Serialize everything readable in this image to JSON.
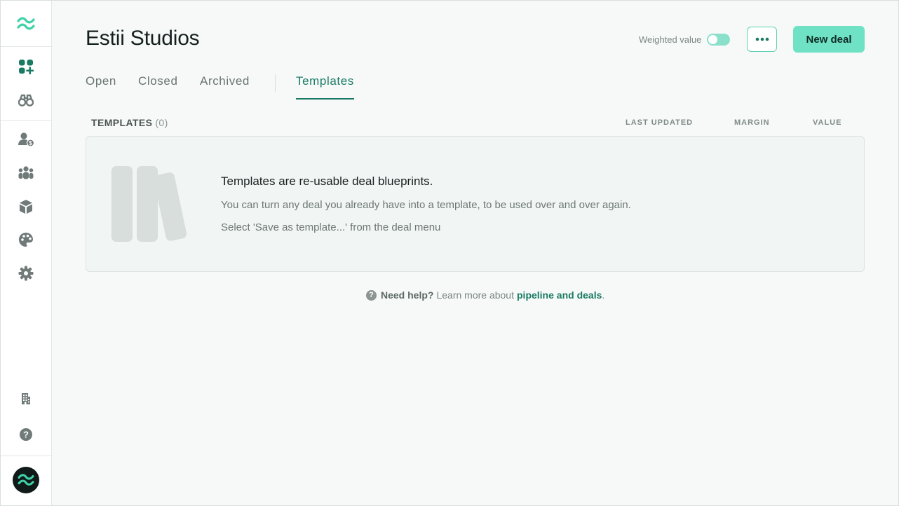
{
  "app": {
    "workspace_title": "Estii Studios"
  },
  "sidebar": {
    "items": [
      {
        "name": "deals-icon"
      },
      {
        "name": "discover-icon"
      },
      {
        "name": "clients-icon"
      },
      {
        "name": "team-icon"
      },
      {
        "name": "products-icon"
      },
      {
        "name": "themes-icon"
      },
      {
        "name": "settings-icon"
      },
      {
        "name": "organization-icon"
      },
      {
        "name": "help-icon"
      }
    ]
  },
  "header": {
    "weighted_label": "Weighted value",
    "weighted_enabled": false,
    "new_deal_label": "New deal"
  },
  "tabs": [
    {
      "label": "Open",
      "active": false
    },
    {
      "label": "Closed",
      "active": false
    },
    {
      "label": "Archived",
      "active": false
    },
    {
      "label": "Templates",
      "active": true
    }
  ],
  "table": {
    "title": "TEMPLATES",
    "count": "(0)",
    "columns": {
      "last_updated": "LAST UPDATED",
      "margin": "MARGIN",
      "value": "VALUE"
    }
  },
  "empty_state": {
    "title": "Templates are re-usable deal blueprints.",
    "line1": "You can turn any deal you already have into a template, to be used over and over again.",
    "line2": "Select 'Save as template...' from the deal menu"
  },
  "help": {
    "prefix": "Need help?",
    "text": "Learn more about",
    "link": "pipeline and deals",
    "suffix": "."
  },
  "colors": {
    "accent": "#1a7a63",
    "button": "#6fe2c5",
    "brand": "#3fd1a8"
  }
}
